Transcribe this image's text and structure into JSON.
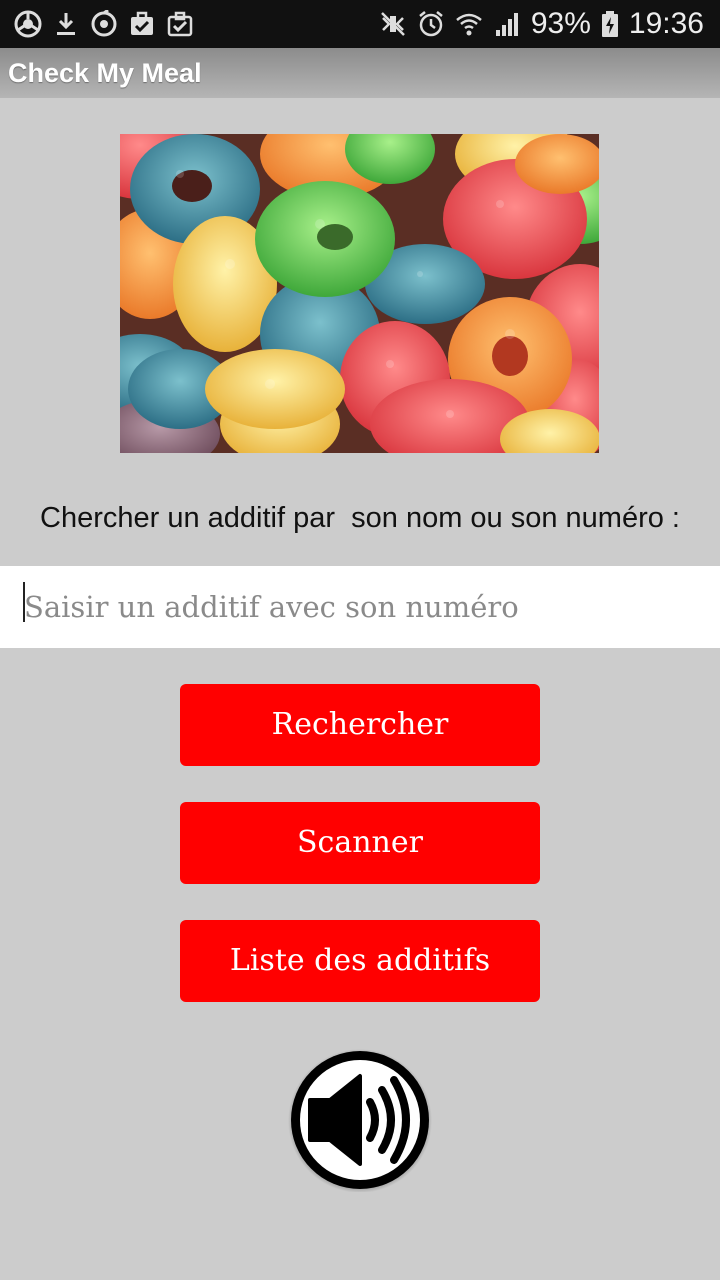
{
  "status_bar": {
    "left_icons": [
      "chrome-icon",
      "download-icon",
      "sync-icon",
      "task-icon",
      "task-check-icon"
    ],
    "right_icons": [
      "mute-icon",
      "alarm-icon",
      "wifi-icon",
      "signal-icon",
      "battery-icon"
    ],
    "battery": "93%",
    "time": "19:36"
  },
  "app": {
    "title": "Check My Meal"
  },
  "main": {
    "image_alt": "cereal-image",
    "prompt": "Chercher un additif par  son nom ou son numéro :",
    "search": {
      "value": "",
      "placeholder": "Saisir un additif avec son numéro"
    },
    "buttons": {
      "search_label": "Rechercher",
      "scan_label": "Scanner",
      "list_label": "Liste des additifs"
    },
    "speaker_icon": "speaker-icon"
  },
  "colors": {
    "background": "#cccccc",
    "button": "#ff0000",
    "status_bar": "#111111"
  }
}
